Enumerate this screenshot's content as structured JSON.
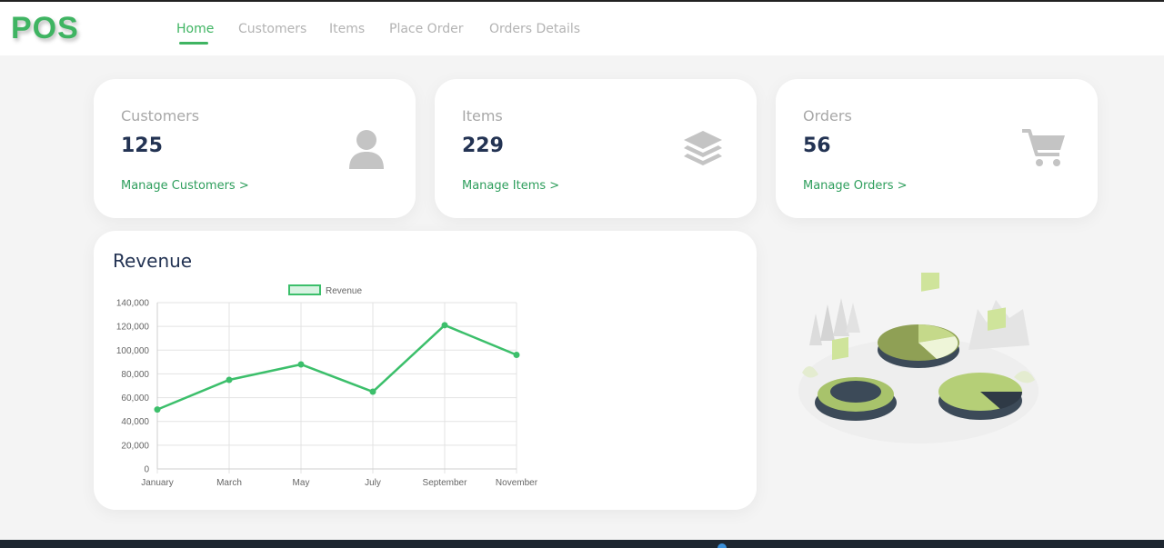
{
  "app": {
    "logo": "POS"
  },
  "nav": {
    "items": [
      {
        "label": "Home",
        "active": true
      },
      {
        "label": "Customers",
        "active": false
      },
      {
        "label": "Items",
        "active": false
      },
      {
        "label": "Place Order",
        "active": false
      },
      {
        "label": "Orders Details",
        "active": false
      }
    ]
  },
  "stats": {
    "customers": {
      "label": "Customers",
      "value": "125",
      "link": "Manage Customers >",
      "icon": "user-icon"
    },
    "items": {
      "label": "Items",
      "value": "229",
      "link": "Manage Items >",
      "icon": "layers-icon"
    },
    "orders": {
      "label": "Orders",
      "value": "56",
      "link": "Manage Orders >",
      "icon": "cart-icon"
    }
  },
  "revenue": {
    "title": "Revenue"
  },
  "colors": {
    "accent": "#3fb462",
    "line": "#3cbf6b",
    "navy": "#233353"
  },
  "chart_data": {
    "type": "line",
    "title": "",
    "x": [
      "January",
      "March",
      "May",
      "July",
      "September",
      "November"
    ],
    "series": [
      {
        "name": "Revenue",
        "values": [
          50000,
          75000,
          88000,
          65000,
          121000,
          96000
        ]
      }
    ],
    "ylim": [
      0,
      140000
    ],
    "yticks": [
      "0",
      "20,000",
      "40,000",
      "60,000",
      "80,000",
      "100,000",
      "120,000",
      "140,000"
    ],
    "grid": true,
    "legend": "top-center"
  }
}
